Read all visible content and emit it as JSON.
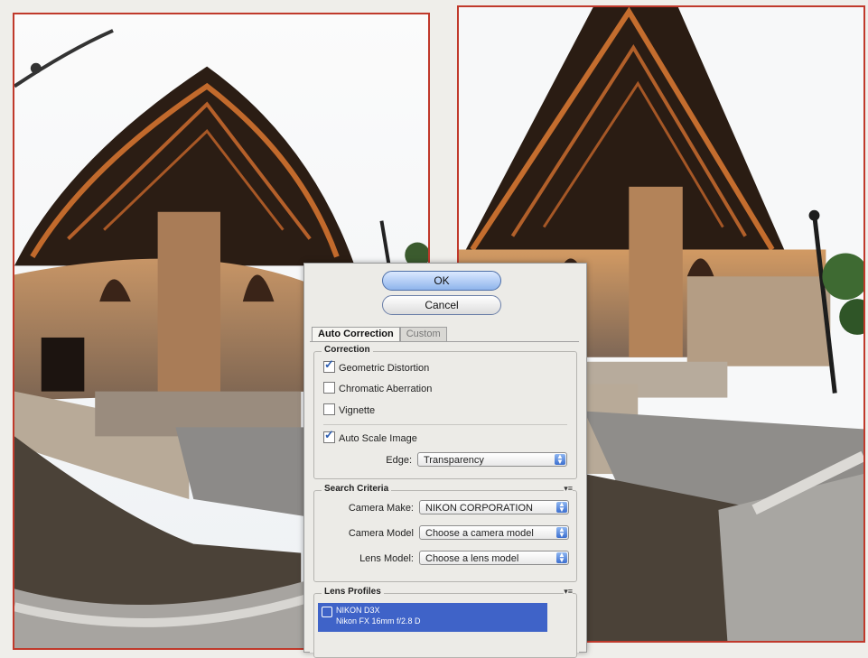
{
  "dialog": {
    "ok_label": "OK",
    "cancel_label": "Cancel",
    "tabs": [
      {
        "label": "Auto Correction",
        "active": true
      },
      {
        "label": "Custom",
        "active": false
      }
    ],
    "correction": {
      "title": "Correction",
      "geometric_distortion": {
        "label": "Geometric Distortion",
        "checked": true
      },
      "chromatic_aberration": {
        "label": "Chromatic Aberration",
        "checked": false
      },
      "vignette": {
        "label": "Vignette",
        "checked": false
      },
      "auto_scale_image": {
        "label": "Auto Scale Image",
        "checked": true
      },
      "edge_label": "Edge:",
      "edge_value": "Transparency"
    },
    "search_criteria": {
      "title": "Search Criteria",
      "camera_make_label": "Camera Make:",
      "camera_make_value": "NIKON CORPORATION",
      "camera_model_label": "Camera Model",
      "camera_model_value": "Choose a camera model",
      "lens_model_label": "Lens Model:",
      "lens_model_value": "Choose a lens model"
    },
    "lens_profiles": {
      "title": "Lens Profiles",
      "items": [
        {
          "line1": "NIKON D3X",
          "line2": "Nikon FX 16mm f/2.8 D"
        }
      ]
    }
  },
  "colors": {
    "frame_border": "#c0392b",
    "ok_button": "#8fb4ec",
    "selection": "#3f63c8"
  }
}
